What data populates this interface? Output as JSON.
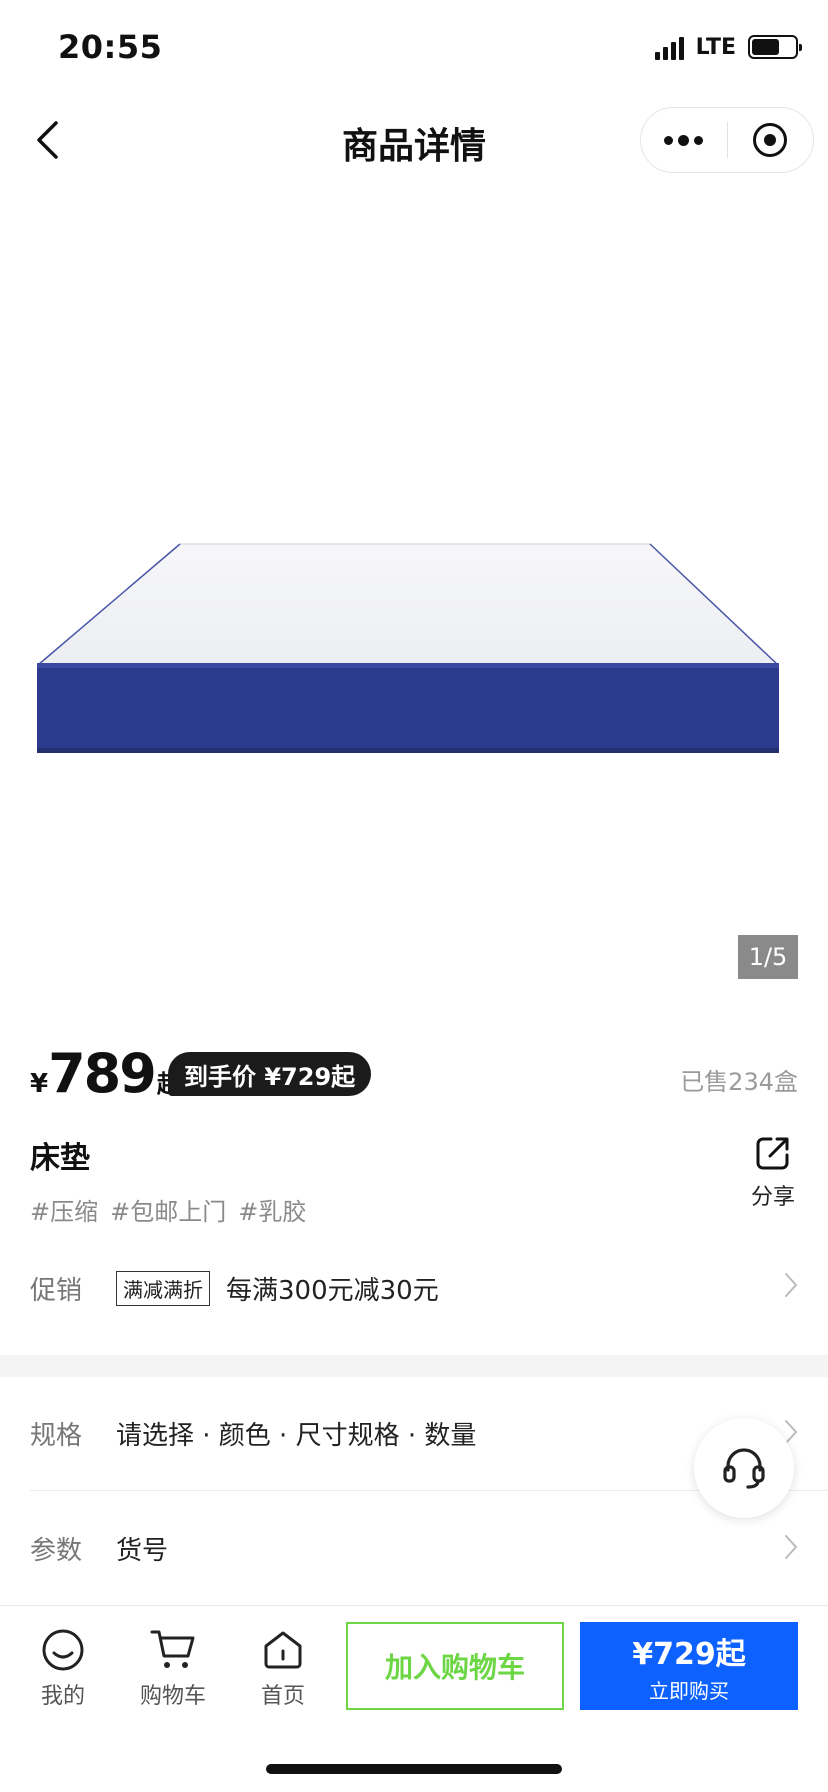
{
  "status_bar": {
    "time": "20:55",
    "network": "LTE",
    "battery_level": 0.65
  },
  "nav": {
    "title": "商品详情"
  },
  "gallery": {
    "current": "1",
    "total": "5",
    "indicator": "1/5"
  },
  "product": {
    "currency": "¥",
    "price": "789",
    "price_suffix": "起",
    "final_price_label": "到手价 ¥729起",
    "sold": "已售234盒",
    "title": "床垫",
    "share_label": "分享",
    "tags": [
      "#压缩",
      "#包邮上门",
      "#乳胶"
    ]
  },
  "promo": {
    "label": "促销",
    "badge": "满减满折",
    "text": "每满300元减30元"
  },
  "spec": {
    "label": "规格",
    "value": "请选择 · 颜色 · 尺寸规格 · 数量"
  },
  "params": {
    "label": "参数",
    "value": "货号"
  },
  "tabs": [
    {
      "label": "我的",
      "icon": "smile-icon"
    },
    {
      "label": "购物车",
      "icon": "cart-icon"
    },
    {
      "label": "首页",
      "icon": "home-icon"
    }
  ],
  "actions": {
    "add_to_cart": "加入购物车",
    "buy_price": "¥729起",
    "buy_label": "立即购买"
  },
  "colors": {
    "accent_blue": "#0d62ff",
    "accent_green": "#6cd645",
    "mattress_side": "#2b3a8c"
  }
}
